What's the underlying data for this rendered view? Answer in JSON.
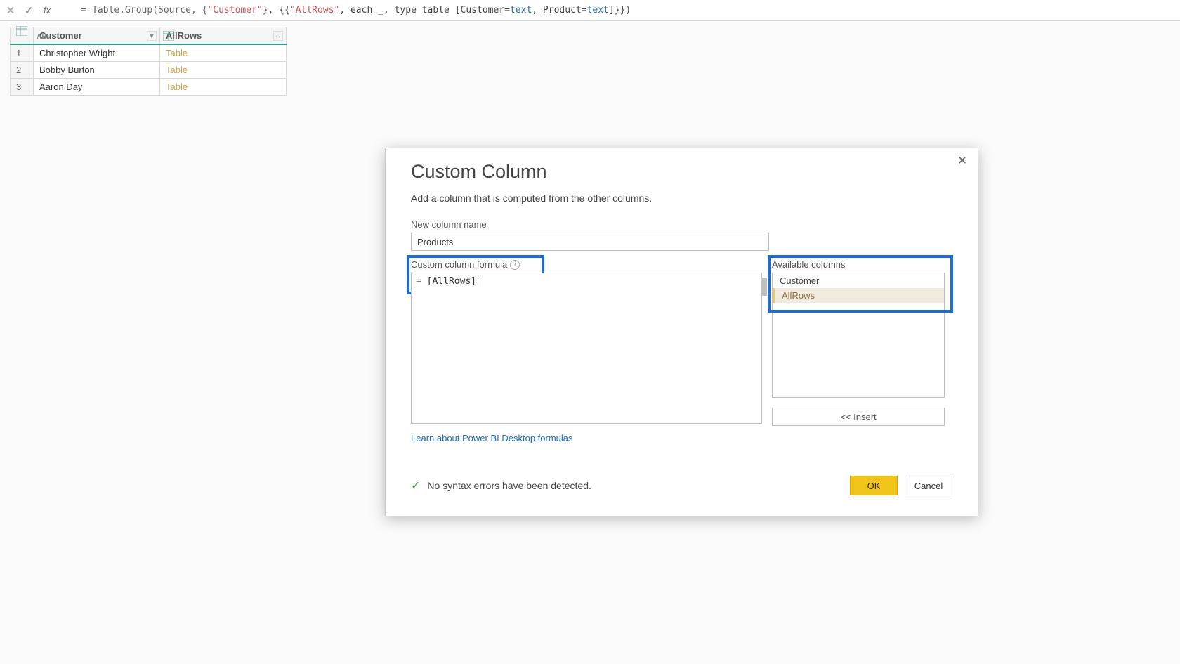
{
  "formula_bar": {
    "fx": "fx",
    "prefix": "= Table.Group(Source, {",
    "hi1": "\"Customer\"",
    "mid1": "}, {{",
    "hi2": "\"AllRows\"",
    "mid2": ", each _, type table [Customer=",
    "kw1": "text",
    "mid3": ", Product=",
    "kw2": "text",
    "suffix": "]}})"
  },
  "table": {
    "headers": {
      "index": "",
      "customer": "Customer",
      "allrows": "AllRows"
    },
    "rows": [
      {
        "n": "1",
        "customer": "Christopher Wright",
        "allrows": "Table"
      },
      {
        "n": "2",
        "customer": "Bobby Burton",
        "allrows": "Table"
      },
      {
        "n": "3",
        "customer": "Aaron Day",
        "allrows": "Table"
      }
    ]
  },
  "dialog": {
    "title": "Custom Column",
    "subtitle": "Add a column that is computed from the other columns.",
    "new_col_label": "New column name",
    "new_col_value": "Products",
    "formula_label": "Custom column formula",
    "formula_text": "= [AllRows]",
    "avail_label": "Available columns",
    "avail_items": [
      "Customer",
      "AllRows"
    ],
    "insert": "<< Insert",
    "learn": "Learn about Power BI Desktop formulas",
    "status": "No syntax errors have been detected.",
    "ok": "OK",
    "cancel": "Cancel"
  }
}
